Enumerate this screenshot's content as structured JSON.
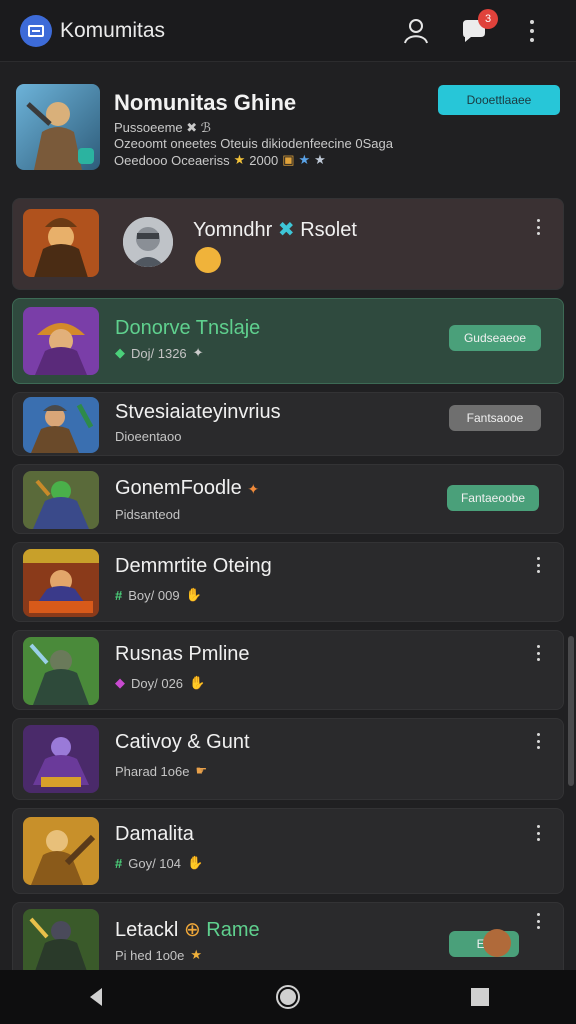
{
  "app": {
    "title": "Komumitas"
  },
  "header": {
    "notification_count": "3"
  },
  "featured": {
    "title": "Nomunitas Ghine",
    "line1": "Pussoeeme ✖ ℬ",
    "line2": "Ozeoomt oneetes Oteuis dikiodenfeecine 0Saga",
    "line3": "Oeedooo Oceaeriss",
    "line3_value": "2000",
    "button_label": "Dooettlaaee"
  },
  "items": [
    {
      "title": "Yomndhr",
      "title_extra": "Rsolet",
      "type": "avatar"
    },
    {
      "title": "Donorve Tnslaje",
      "sub": "Doj/ 1326",
      "button": "Gudseaeoe",
      "type": "green"
    },
    {
      "title": "Stvesiaiateyinvrius",
      "sub": "Dioeentaoo",
      "button": "Fantsaooe"
    },
    {
      "title": "GonemFoodle",
      "sub": "Pidsanteod",
      "button": "Fantaeoobe"
    },
    {
      "title": "Demmrtite Oteing",
      "sub": "Boy/ 009"
    },
    {
      "title": "Rusnas Pmline",
      "sub": "Doy/ 026"
    },
    {
      "title": "Cativoy & Gunt",
      "sub": "Pharad 1o6e"
    },
    {
      "title": "Damalita",
      "sub": "Goy/ 104"
    },
    {
      "title": "Letackl",
      "title_extra": "Rame",
      "sub": "Pi hed 1o0e",
      "button": "Ea"
    }
  ],
  "colors": {
    "accent": "#27c6d8",
    "green": "#4aa07a",
    "badge": "#e0423b"
  },
  "icons": [
    "app-icon",
    "user-icon",
    "chat-icon",
    "more-icon",
    "back-icon",
    "home-icon",
    "recents-icon"
  ]
}
